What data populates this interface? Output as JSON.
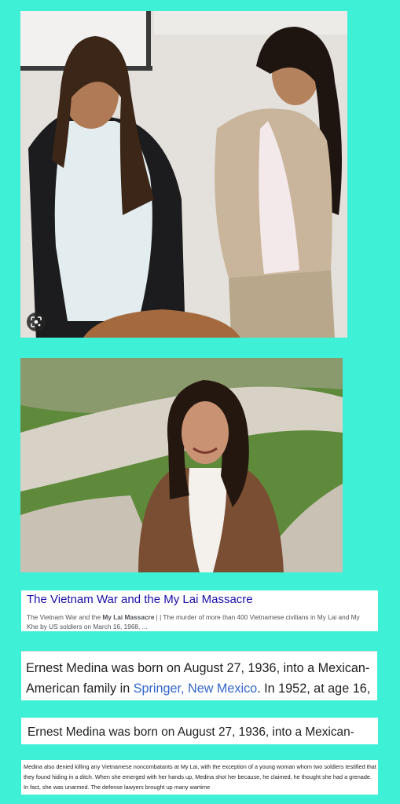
{
  "photos": {
    "top": {
      "lens_icon": "google-lens-icon"
    },
    "bottom": {}
  },
  "search_result": {
    "title": "The Vietnam War and the My Lai Massacre",
    "snippet_before": "The Vietnam War and the ",
    "snippet_bold": "My Lai Massacre",
    "snippet_after": " | | The murder of more than 400 Vietnamese civilians in My Lai and My Khe by US soldiers on March 16, 1968, ..."
  },
  "wiki_excerpt": {
    "line1": "Ernest Medina was born on August 27, 1936, into a Mexican-",
    "line2_before": "American family in ",
    "line2_link": "Springer, New Mexico",
    "line2_after": ". In 1952, at age 16,"
  },
  "wiki_excerpt_2": {
    "line1": "Ernest Medina was born on August 27, 1936, into a Mexican-"
  },
  "paragraph": {
    "text": "Medina also denied killing any Vietnamese noncombatants at My Lai, with the exception of a young woman whom two soldiers testified that they found hiding in a ditch. When she emerged with her hands up, Medina shot her because, he claimed, he thought she had a grenade. In fact, she was unarmed. The defense lawyers brought up many wartime"
  },
  "colors": {
    "background": "#3ef0d6",
    "link_title": "#1a0dab",
    "link_wiki": "#3366cc"
  }
}
